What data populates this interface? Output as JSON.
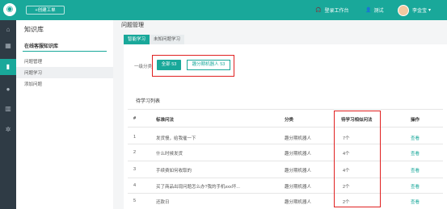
{
  "header": {
    "create_button": "+创建工单",
    "workbench": "登录工作台",
    "user_label": "测试",
    "account_name": "李金宝",
    "account_caret": "▾"
  },
  "rail": {
    "icons": [
      "home-icon",
      "grid-icon",
      "book-icon",
      "person-icon",
      "chart-icon",
      "settings-icon"
    ],
    "active_index": 2
  },
  "sidebar": {
    "title": "知识库",
    "section": "在线客服知识库",
    "items": [
      {
        "label": "问题管理"
      },
      {
        "label": "问题学习"
      },
      {
        "label": "添加问题"
      }
    ],
    "active_index": 1
  },
  "main": {
    "breadcrumb": "问题管理",
    "tabs": [
      {
        "label": "智能学习"
      },
      {
        "label": "未知问题学习"
      }
    ],
    "active_tab": 0,
    "category_label": "一级分类",
    "category_all": "全部 53",
    "category_robot": "趣分期机器人 53",
    "list_title": "待学习列表",
    "columns": [
      "#",
      "标准问法",
      "分类",
      "待学习相似问法",
      "操作"
    ],
    "rows": [
      {
        "no": "1",
        "question": "发货慢，给我催一下",
        "category": "趣分期机器人",
        "count": "7个",
        "action": "查看"
      },
      {
        "no": "2",
        "question": "什么时候发货",
        "category": "趣分期机器人",
        "count": "4个",
        "action": "查看"
      },
      {
        "no": "3",
        "question": "手续费如何收取的",
        "category": "趣分期机器人",
        "count": "4个",
        "action": "查看"
      },
      {
        "no": "4",
        "question": "买了商品出现问题怎么办?我的手机xxx坏...",
        "category": "趣分期机器人",
        "count": "2个",
        "action": "查看"
      },
      {
        "no": "5",
        "question": "还款日",
        "category": "趣分期机器人",
        "count": "2个",
        "action": "查看"
      }
    ]
  },
  "colors": {
    "accent": "#19a89a",
    "highlight": "#e02020",
    "rail": "#2f3b45"
  }
}
